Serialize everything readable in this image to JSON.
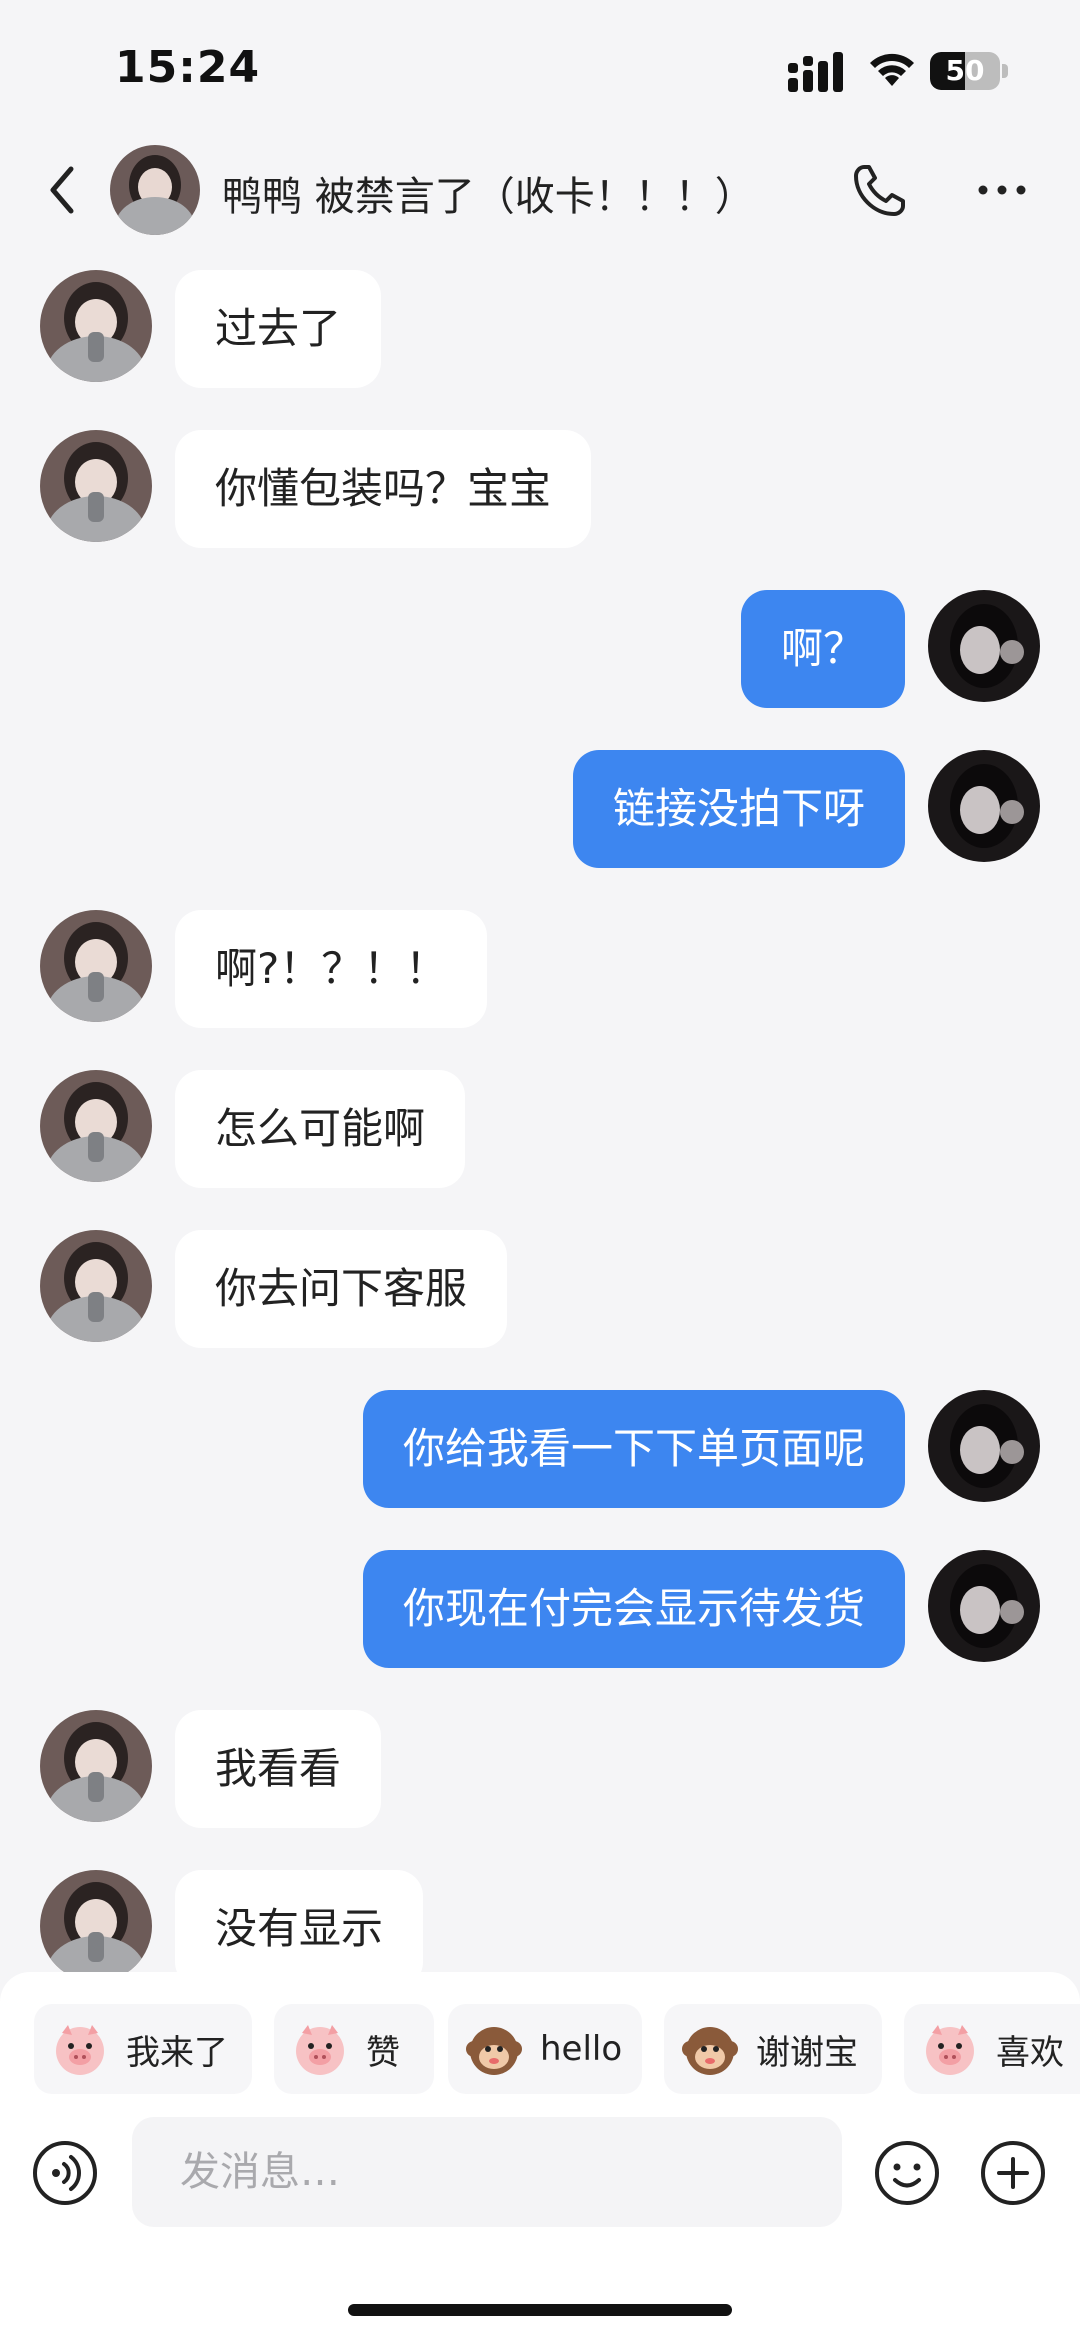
{
  "status_bar": {
    "time": "15:24",
    "battery_level": "50",
    "battery_fraction": 0.5
  },
  "header": {
    "title": "鸭鸭 被禁言了（收卡！！！）",
    "back_icon": "chevron-left-icon",
    "call_icon": "phone-icon",
    "more_icon": "more-dots-icon"
  },
  "messages": [
    {
      "side": "in",
      "text": "过去了"
    },
    {
      "side": "in",
      "text": "你懂包装吗？宝宝"
    },
    {
      "side": "out",
      "text": "啊？"
    },
    {
      "side": "out",
      "text": "链接没拍下呀"
    },
    {
      "side": "in",
      "text": "啊?！？！！"
    },
    {
      "side": "in",
      "text": "怎么可能啊"
    },
    {
      "side": "in",
      "text": "你去问下客服"
    },
    {
      "side": "out",
      "text": "你给我看一下下单页面呢"
    },
    {
      "side": "out",
      "text": "你现在付完会显示待发货"
    },
    {
      "side": "in",
      "text": "我看看"
    },
    {
      "side": "in",
      "text": "没有显示"
    }
  ],
  "quick_replies": [
    {
      "label": "我来了",
      "icon": "pig-sticker-icon"
    },
    {
      "label": "赞",
      "icon": "pig-sticker-icon"
    },
    {
      "label": "hello",
      "icon": "monkey-sticker-icon"
    },
    {
      "label": "谢谢宝",
      "icon": "monkey-sticker-icon"
    },
    {
      "label": "喜欢",
      "icon": "pig-sticker-icon"
    }
  ],
  "composer": {
    "placeholder": "发消息…",
    "voice_icon": "voice-icon",
    "emoji_icon": "smiley-icon",
    "plus_icon": "plus-icon"
  },
  "colors": {
    "background": "#f5f5f7",
    "incoming_bubble": "#ffffff",
    "outgoing_bubble": "#3d86f0",
    "outgoing_text": "#ffffff"
  }
}
